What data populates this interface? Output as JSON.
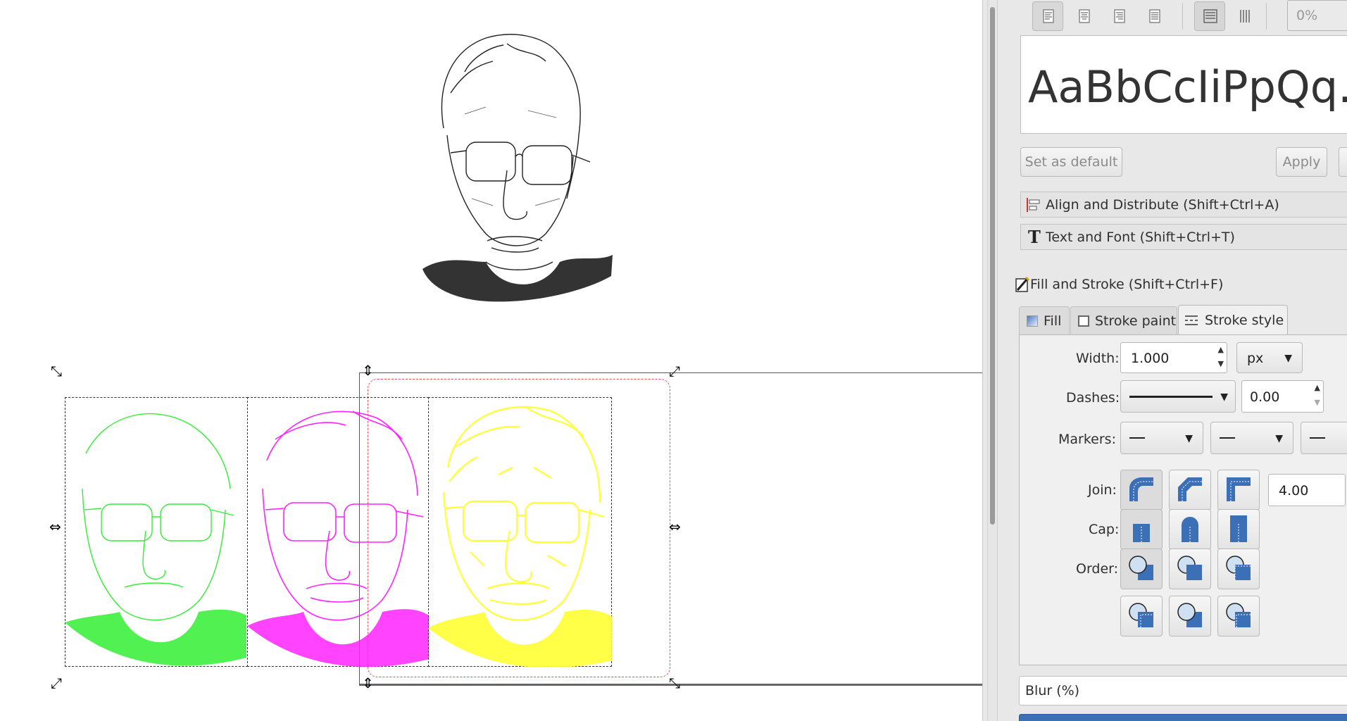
{
  "panel": {
    "alignment_buttons": [
      "align-left-icon",
      "align-center-icon",
      "align-right-icon",
      "align-justify-icon"
    ],
    "percent_value": "0%",
    "font_preview": "AaBbCcIiPpQq.",
    "set_default_label": "Set as default",
    "apply_label": "Apply",
    "align_distribute_label": "Align and Distribute (Shift+Ctrl+A)",
    "text_font_label": "Text and Font (Shift+Ctrl+T)",
    "fill_stroke_label": "Fill and Stroke (Shift+Ctrl+F)",
    "tabs": [
      {
        "label": "Fill"
      },
      {
        "label": "Stroke paint"
      },
      {
        "label": "Stroke style"
      }
    ],
    "stroke_style": {
      "width_label": "Width:",
      "width_value": "1.000",
      "unit": "px",
      "dashes_label": "Dashes:",
      "dash_offset": "0.00",
      "markers_label": "Markers:",
      "join_label": "Join:",
      "miter_value": "4.00",
      "cap_label": "Cap:",
      "order_label": "Order:"
    },
    "blur_label": "Blur (%)"
  },
  "colors": {
    "green": "#33ee33",
    "magenta": "#ff22ff",
    "yellow": "#ffff33",
    "ink": "#222222",
    "selection_blue": "#3b6fb6"
  }
}
